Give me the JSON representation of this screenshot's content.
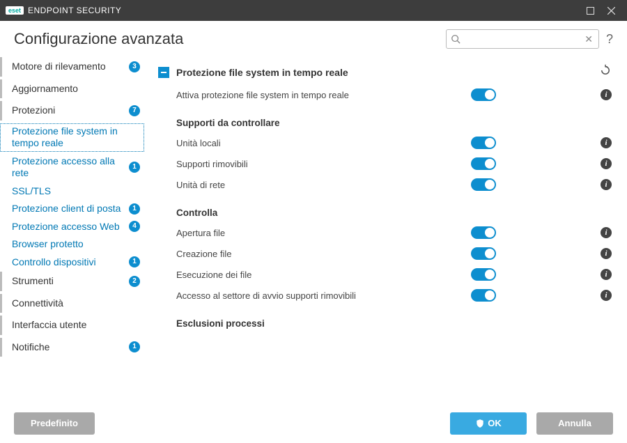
{
  "titlebar": {
    "brand_prefix": "eset",
    "brand_text": "ENDPOINT SECURITY"
  },
  "header": {
    "title": "Configurazione avanzata",
    "search_placeholder": "",
    "help": "?"
  },
  "sidebar": {
    "items": [
      {
        "label": "Motore di rilevamento",
        "badge": "3",
        "type": "top"
      },
      {
        "label": "Aggiornamento",
        "badge": "",
        "type": "top"
      },
      {
        "label": "Protezioni",
        "badge": "7",
        "type": "top"
      },
      {
        "label": "Protezione file system in tempo reale",
        "badge": "",
        "type": "sub",
        "selected": true
      },
      {
        "label": "Protezione accesso alla rete",
        "badge": "1",
        "type": "sub"
      },
      {
        "label": "SSL/TLS",
        "badge": "",
        "type": "sub"
      },
      {
        "label": "Protezione client di posta",
        "badge": "1",
        "type": "sub"
      },
      {
        "label": "Protezione accesso Web",
        "badge": "4",
        "type": "sub"
      },
      {
        "label": "Browser protetto",
        "badge": "",
        "type": "sub"
      },
      {
        "label": "Controllo dispositivi",
        "badge": "1",
        "type": "sub"
      },
      {
        "label": "Strumenti",
        "badge": "2",
        "type": "top"
      },
      {
        "label": "Connettività",
        "badge": "",
        "type": "top"
      },
      {
        "label": "Interfaccia utente",
        "badge": "",
        "type": "top"
      },
      {
        "label": "Notifiche",
        "badge": "1",
        "type": "top"
      }
    ]
  },
  "main": {
    "section_title": "Protezione file system in tempo reale",
    "enable_row": {
      "label": "Attiva protezione file system in tempo reale"
    },
    "group_media": {
      "title": "Supporti da controllare",
      "rows": [
        {
          "label": "Unità locali"
        },
        {
          "label": "Supporti rimovibili"
        },
        {
          "label": "Unità di rete"
        }
      ]
    },
    "group_scan": {
      "title": "Controlla",
      "rows": [
        {
          "label": "Apertura file"
        },
        {
          "label": "Creazione file"
        },
        {
          "label": "Esecuzione dei file"
        },
        {
          "label": "Accesso al settore di avvio supporti rimovibili"
        }
      ]
    },
    "group_exclusions": {
      "title": "Esclusioni processi"
    }
  },
  "footer": {
    "default": "Predefinito",
    "ok": "OK",
    "cancel": "Annulla"
  }
}
